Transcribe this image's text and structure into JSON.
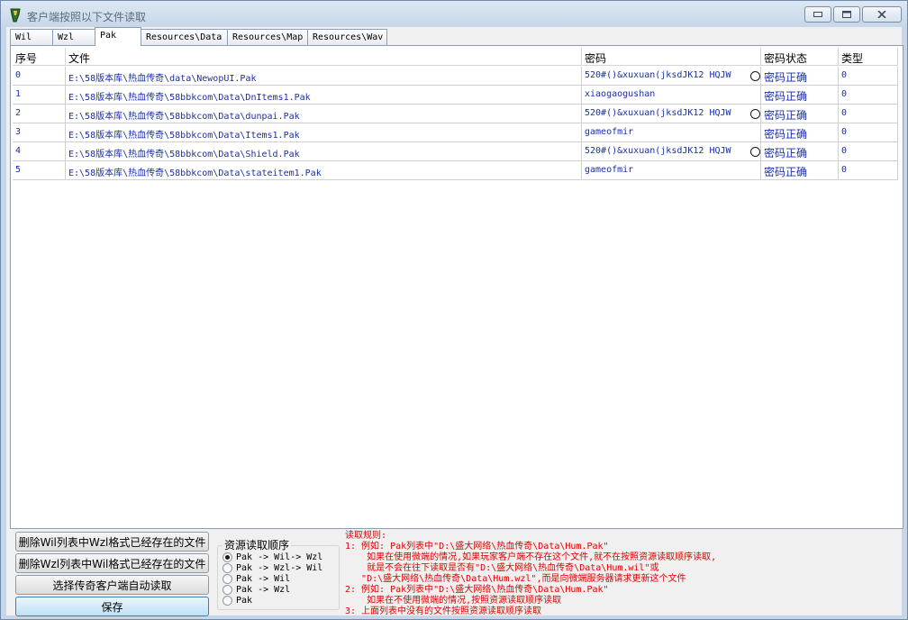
{
  "window": {
    "title": "客户端按照以下文件读取",
    "minimize": "▭",
    "maximize": "□",
    "close": "✕"
  },
  "tabs": [
    {
      "label": "Wil"
    },
    {
      "label": "Wzl"
    },
    {
      "label": "Pak"
    },
    {
      "label": "Resources\\Data"
    },
    {
      "label": "Resources\\Map"
    },
    {
      "label": "Resources\\Wav"
    }
  ],
  "list": {
    "columns": [
      "序号",
      "文件",
      "密码",
      "密码状态",
      "类型"
    ],
    "rows": [
      {
        "index": "0",
        "file": "E:\\58版本库\\热血传奇\\data\\NewopUI.Pak",
        "password": "520#()&xuxuan(jksdJK12  HQJW",
        "status": "密码正确",
        "type": "0",
        "status_icon": true
      },
      {
        "index": "1",
        "file": "E:\\58版本库\\热血传奇\\58bbkcom\\Data\\DnItems1.Pak",
        "password": "xiaogaogushan",
        "status": "密码正确",
        "type": "0",
        "status_icon": false
      },
      {
        "index": "2",
        "file": "E:\\58版本库\\热血传奇\\58bbkcom\\Data\\dunpai.Pak",
        "password": "520#()&xuxuan(jksdJK12  HQJW",
        "status": "密码正确",
        "type": "0",
        "status_icon": true
      },
      {
        "index": "3",
        "file": "E:\\58版本库\\热血传奇\\58bbkcom\\Data\\Items1.Pak",
        "password": "gameofmir",
        "status": "密码正确",
        "type": "0",
        "status_icon": false
      },
      {
        "index": "4",
        "file": "E:\\58版本库\\热血传奇\\58bbkcom\\Data\\Shield.Pak",
        "password": "520#()&xuxuan(jksdJK12  HQJW",
        "status": "密码正确",
        "type": "0",
        "status_icon": true
      },
      {
        "index": "5",
        "file": "E:\\58版本库\\热血传奇\\58bbkcom\\Data\\stateitem1.Pak",
        "password": "gameofmir",
        "status": "密码正确",
        "type": "0",
        "status_icon": false
      }
    ]
  },
  "buttons": {
    "delete_wil": "删除Wil列表中Wzl格式已经存在的文件",
    "delete_wzl": "删除Wzl列表中Wil格式已经存在的文件",
    "auto_read": "选择传奇客户端自动读取",
    "save": "保存"
  },
  "read_order": {
    "title": "资源读取顺序",
    "options": [
      {
        "label": "Pak -> Wil-> Wzl",
        "checked": true
      },
      {
        "label": "Pak -> Wzl-> Wil",
        "checked": false
      },
      {
        "label": "Pak -> Wil",
        "checked": false
      },
      {
        "label": "Pak -> Wzl",
        "checked": false
      },
      {
        "label": "Pak",
        "checked": false
      }
    ]
  },
  "rules": {
    "lines": [
      "读取规则:",
      "1: 例如: Pak列表中\"D:\\盛大网络\\热血传奇\\Data\\Hum.Pak\"",
      "    如果在使用微端的情况,如果玩家客户端不存在这个文件,就不在按照资源读取顺序读取,",
      "    就是不会在往下读取是否有\"D:\\盛大网络\\热血传奇\\Data\\Hum.wil\"或",
      "   \"D:\\盛大网络\\热血传奇\\Data\\Hum.wzl\",而是向微端服务器请求更新这个文件",
      "2: 例如: Pak列表中\"D:\\盛大网络\\热血传奇\\Data\\Hum.Pak\"",
      "    如果在不使用微端的情况,按照资源读取顺序读取",
      "3: 上面列表中没有的文件按照资源读取顺序读取"
    ]
  }
}
